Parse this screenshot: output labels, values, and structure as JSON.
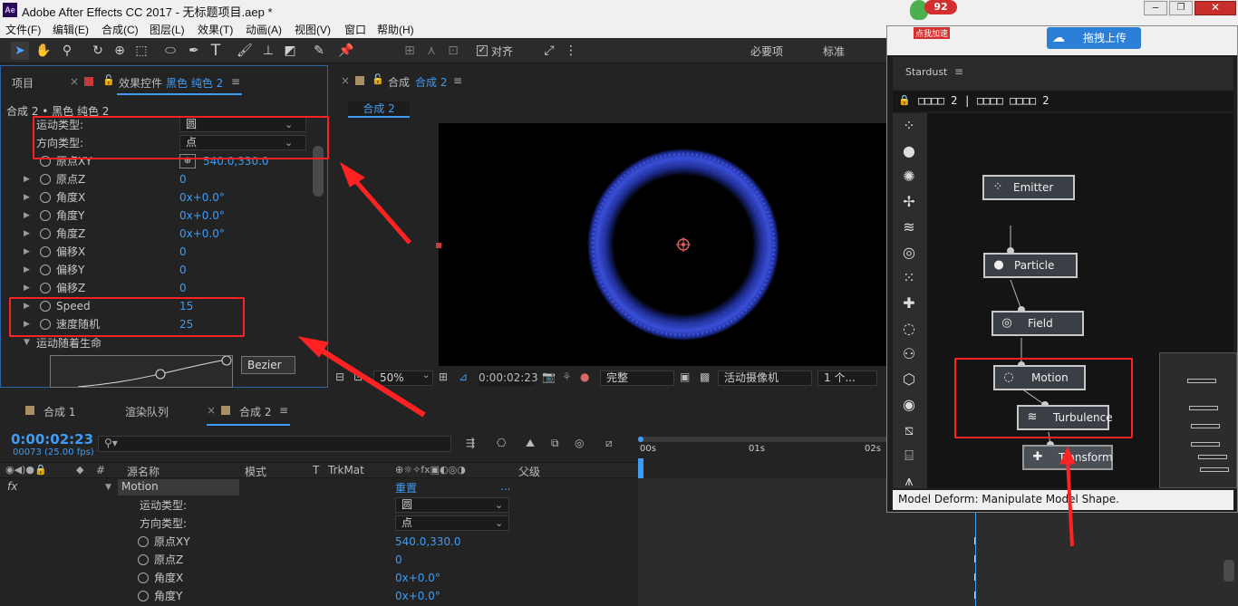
{
  "title_bar": {
    "text": "Adobe After Effects CC 2017 - 无标题项目.aep *",
    "app_icon": "Ae"
  },
  "menu": [
    "文件(F)",
    "编辑(E)",
    "合成(C)",
    "图层(L)",
    "效果(T)",
    "动画(A)",
    "视图(V)",
    "窗口",
    "帮助(H)"
  ],
  "toolbar": {
    "align_label": "对齐",
    "workspaces": [
      "必要项",
      "标准"
    ]
  },
  "overlay": {
    "badge": "92",
    "speed_label": "点我加速",
    "upload_label": "拖拽上传"
  },
  "project_panel": {
    "tab_project": "项目",
    "tab_effects": "效果控件",
    "layer_name": "黑色 纯色 2",
    "breadcrumb": "合成 2 • 黑色 纯色 2"
  },
  "effects": [
    {
      "label": "运动类型:",
      "value": "圆",
      "kind": "dropdown"
    },
    {
      "label": "方向类型:",
      "value": "点",
      "kind": "dropdown"
    },
    {
      "label": "原点XY",
      "value": "540.0,330.0",
      "kind": "point"
    },
    {
      "label": "原点Z",
      "value": "0"
    },
    {
      "label": "角度X",
      "value": "0x+0.0°"
    },
    {
      "label": "角度Y",
      "value": "0x+0.0°"
    },
    {
      "label": "角度Z",
      "value": "0x+0.0°"
    },
    {
      "label": "偏移X",
      "value": "0"
    },
    {
      "label": "偏移Y",
      "value": "0"
    },
    {
      "label": "偏移Z",
      "value": "0"
    },
    {
      "label": "Speed",
      "value": "15"
    },
    {
      "label": "速度随机",
      "value": "25"
    }
  ],
  "motion_life_label": "运动随着生命",
  "bezier_label": "Bezier",
  "comp_panel": {
    "tab": "合成",
    "comp_name": "合成 2",
    "comp_tab": "合成 2",
    "zoom": "50%",
    "timecode": "0:00:02:23",
    "quality": "完整",
    "camera": "活动摄像机",
    "views": "1 个..."
  },
  "timeline": {
    "tabs": [
      "合成 1",
      "渲染队列",
      "合成 2"
    ],
    "timecode": "0:00:02:23",
    "frames": "00073 (25.00 fps)",
    "cols": [
      "源名称",
      "模式",
      "T",
      "TrkMat",
      "父级"
    ],
    "ruler": [
      "00s",
      "01s",
      "02s"
    ],
    "effect_name": "Motion",
    "reset": "重置",
    "dots": "...",
    "fx": "fx",
    "rows": [
      {
        "label": "运动类型:",
        "value": "圆",
        "kind": "dropdown"
      },
      {
        "label": "方向类型:",
        "value": "点",
        "kind": "dropdown"
      },
      {
        "label": "原点XY",
        "value": "540.0,330.0"
      },
      {
        "label": "原点Z",
        "value": "0"
      },
      {
        "label": "角度X",
        "value": "0x+0.0°"
      },
      {
        "label": "角度Y",
        "value": "0x+0.0°"
      }
    ]
  },
  "stardust": {
    "title": "Stardust",
    "layer": "□□□□ 2  |  □□□□ □□□□ 2",
    "status": "Model Deform: Manipulate Model Shape.",
    "nodes": [
      "Emitter",
      "Particle",
      "Field",
      "Motion",
      "Turbulence",
      "Transform"
    ]
  },
  "colors": {
    "annotation": "#ff2222",
    "accent": "#3f9cf5",
    "ring": "#3a4fd8"
  }
}
